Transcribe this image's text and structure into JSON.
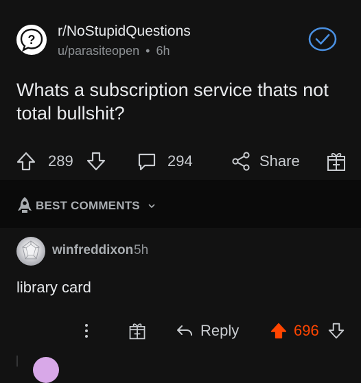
{
  "post": {
    "subreddit": "r/NoStupidQuestions",
    "author": "u/parasiteopen",
    "age": "6h",
    "separator": "•",
    "title": "Whats a subscription service thats not total bullshit?",
    "upvotes": "289",
    "comments": "294",
    "share_label": "Share"
  },
  "sort": {
    "label": "BEST COMMENTS"
  },
  "comment": {
    "username": "winfreddixon",
    "age": "5h",
    "body": "library card",
    "reply_label": "Reply",
    "score": "696"
  },
  "colors": {
    "background": "#121212",
    "upvote_active": "#ff4500",
    "verify_blue": "#4a90e2"
  },
  "icons": {
    "subreddit": "question-mark-icon",
    "verify": "checkmark-circle-icon",
    "upvote": "arrow-up-icon",
    "downvote": "arrow-down-icon",
    "comments": "speech-bubble-icon",
    "share": "share-icon",
    "award": "gift-icon",
    "sort": "rocket-icon",
    "more": "more-vertical-icon",
    "reply": "reply-icon"
  }
}
